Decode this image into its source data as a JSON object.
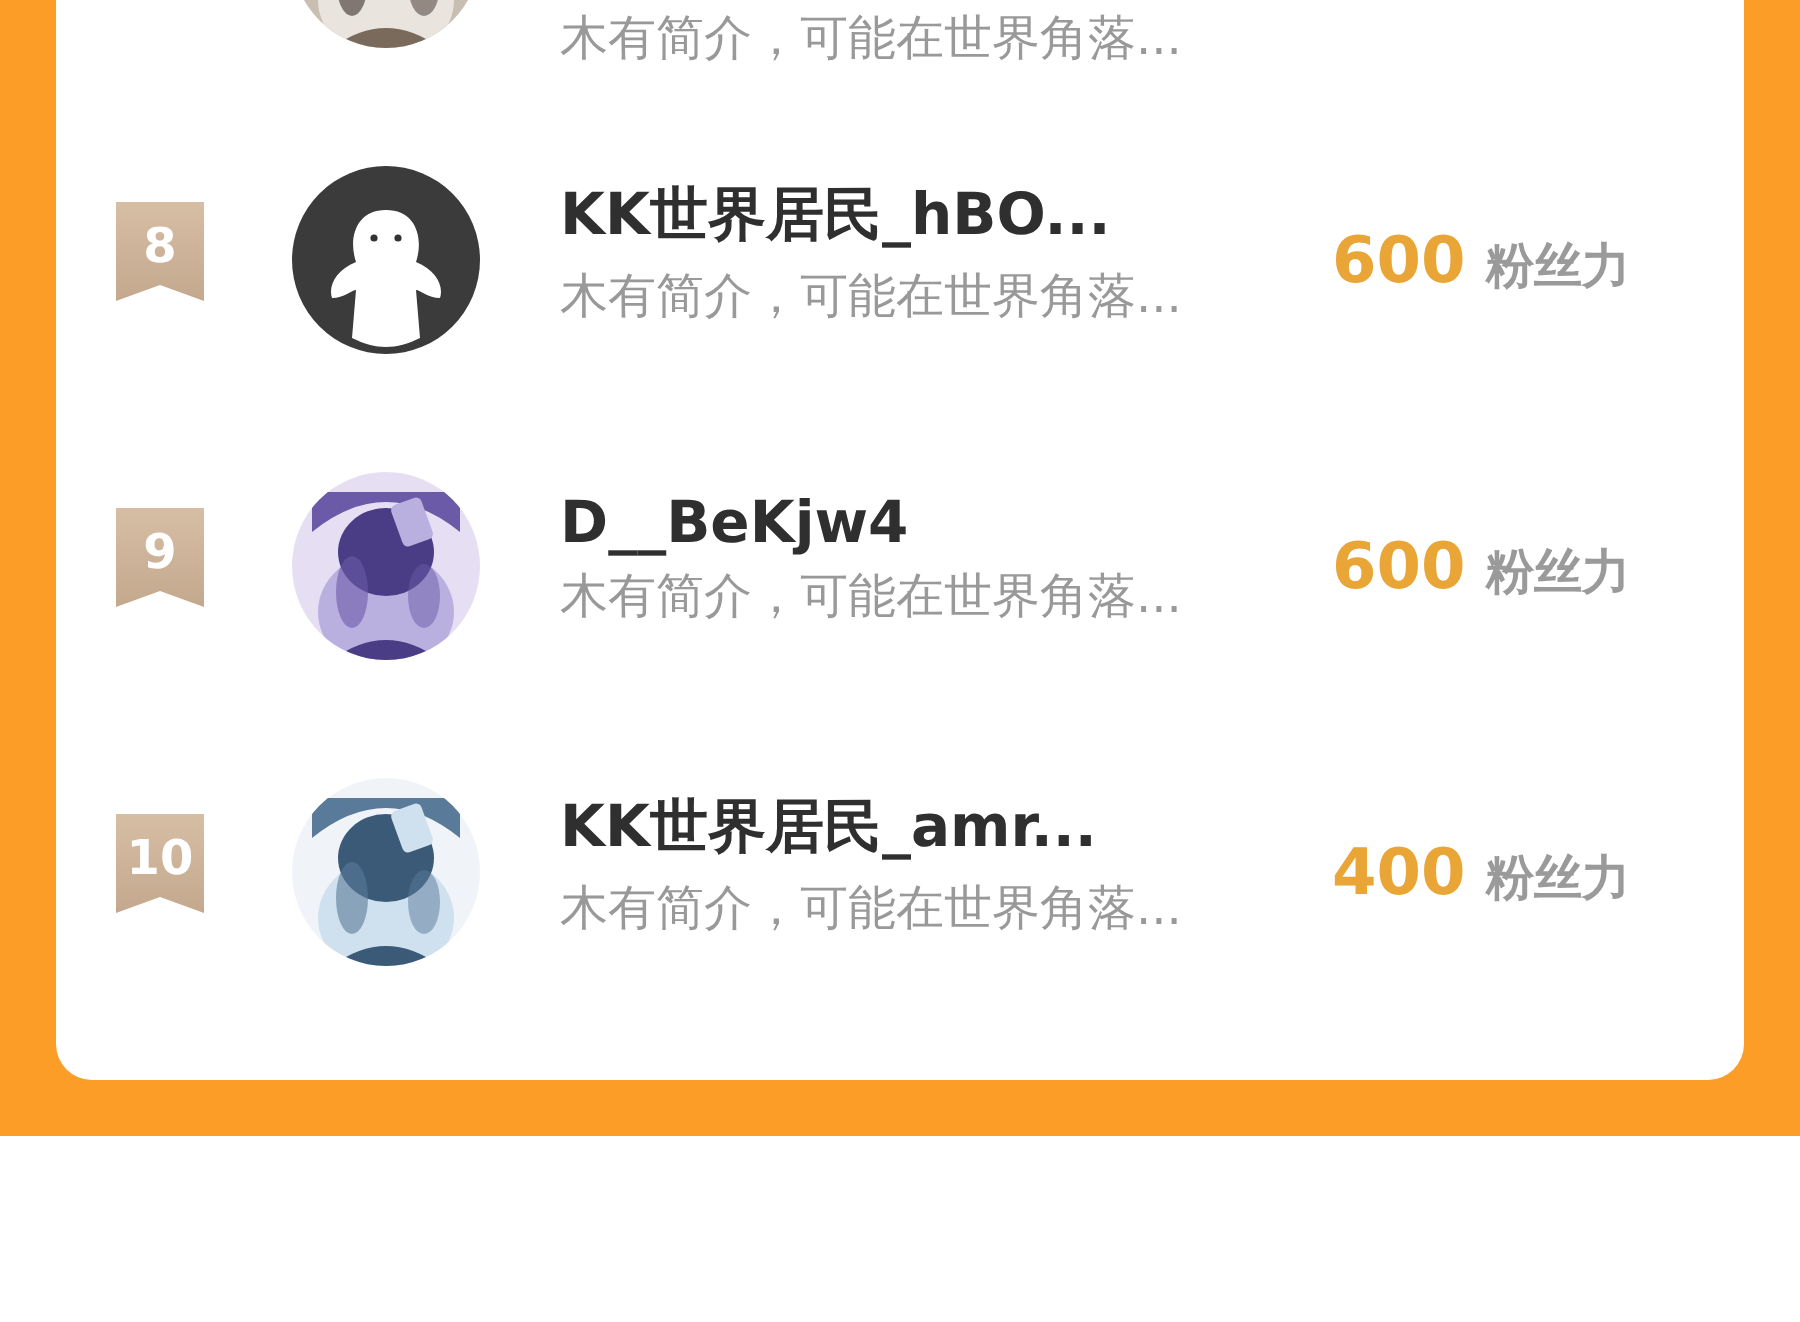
{
  "ranking": [
    {
      "bio": "木有简介，可能在世界角落..."
    },
    {
      "rank": "8",
      "avatar": {
        "kind": "default"
      },
      "name": "KK世界居民_hBO...",
      "bio": "木有简介，可能在世界角落...",
      "score": "600",
      "score_unit": "粉丝力"
    },
    {
      "rank": "9",
      "name": "D__BeKjw4",
      "bio": "木有简介，可能在世界角落...",
      "score": "600",
      "score_unit": "粉丝力"
    },
    {
      "rank": "10",
      "name": "KK世界居民_amr...",
      "bio": "木有简介，可能在世界角落...",
      "score": "400",
      "score_unit": "粉丝力"
    }
  ]
}
